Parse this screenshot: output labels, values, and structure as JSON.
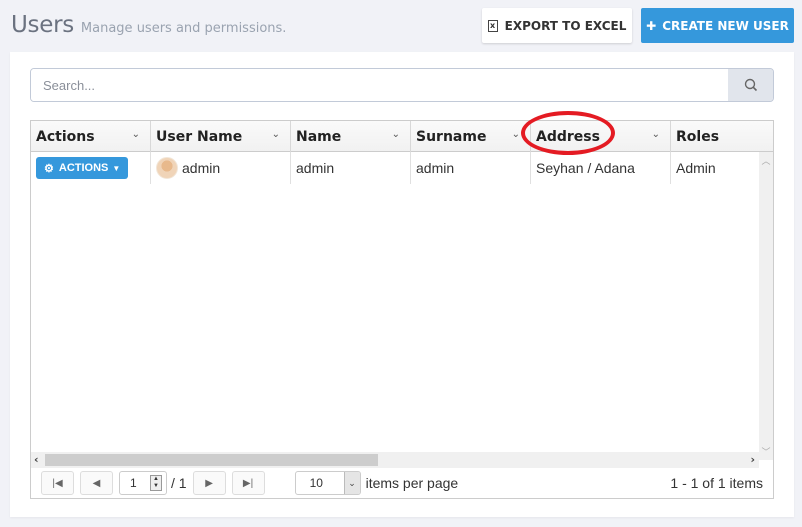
{
  "header": {
    "title": "Users",
    "subtitle": "Manage users and permissions.",
    "export_label": "EXPORT TO EXCEL",
    "export_icon": "file-excel-icon",
    "create_label": "CREATE NEW USER",
    "create_icon": "plus-icon"
  },
  "search": {
    "placeholder": "Search...",
    "value": "",
    "icon": "search-icon"
  },
  "grid": {
    "columns": [
      {
        "label": "Actions"
      },
      {
        "label": "User Name"
      },
      {
        "label": "Name"
      },
      {
        "label": "Surname"
      },
      {
        "label": "Address"
      },
      {
        "label": "Roles"
      }
    ],
    "rows": [
      {
        "actions_label": "ACTIONS",
        "user_name": "admin",
        "name": "admin",
        "surname": "admin",
        "address": "Seyhan / Adana",
        "roles": "Admin"
      }
    ]
  },
  "pager": {
    "current_page": "1",
    "total_pages": "/ 1",
    "page_size": "10",
    "items_per_page_label": "items per page",
    "info": "1 - 1 of 1 items"
  },
  "annotation": {
    "highlighted_column": "Address",
    "color": "#e41b23"
  },
  "colors": {
    "primary": "#3598dc",
    "background": "#f1f2f7"
  }
}
